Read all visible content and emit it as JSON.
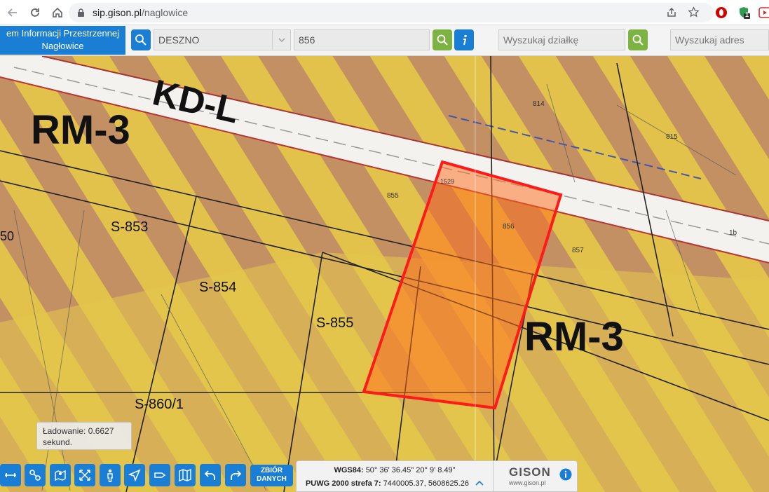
{
  "browser": {
    "url_host": "sip.gison.pl",
    "url_path": "/naglowice",
    "ext_badge": "1"
  },
  "toolbar": {
    "title_line1": "em Informacji Przestrzennej",
    "title_line2": "Nagłowice",
    "district_value": "DESZNO",
    "parcel_value": "856",
    "search_parcel_placeholder": "Wyszukaj działkę",
    "search_address_placeholder": "Wyszukaj adres"
  },
  "map": {
    "labels": {
      "road": "KD-L",
      "zone_left": "RM-3",
      "zone_right": "RM-3",
      "p853": "S-853",
      "p854": "S-854",
      "p855": "S-855",
      "p860": "S-860/1",
      "p50": "50",
      "p856": "856",
      "p855b": "855",
      "p857": "857",
      "p814": "814",
      "p815": "815",
      "p1529": "1529",
      "p1b": "1b"
    },
    "loading_text": "Ładowanie: 0.6627 sekund."
  },
  "bottom": {
    "zbior_line1": "ZBIÓR",
    "zbior_line2": "DANYCH",
    "wgs_label": "WGS84:",
    "wgs_value": "50° 36' 36.45\" 20° 9' 8.49\"",
    "puwg_label": "PUWG 2000 strefa 7:",
    "puwg_value": "7440005.37, 5608625.26",
    "brand": "GISON",
    "brand_site": "www.gison.pl"
  },
  "colors": {
    "accent": "#1a7fd4",
    "search_green": "#7cb342",
    "highlight_red": "#ff1a1a"
  }
}
